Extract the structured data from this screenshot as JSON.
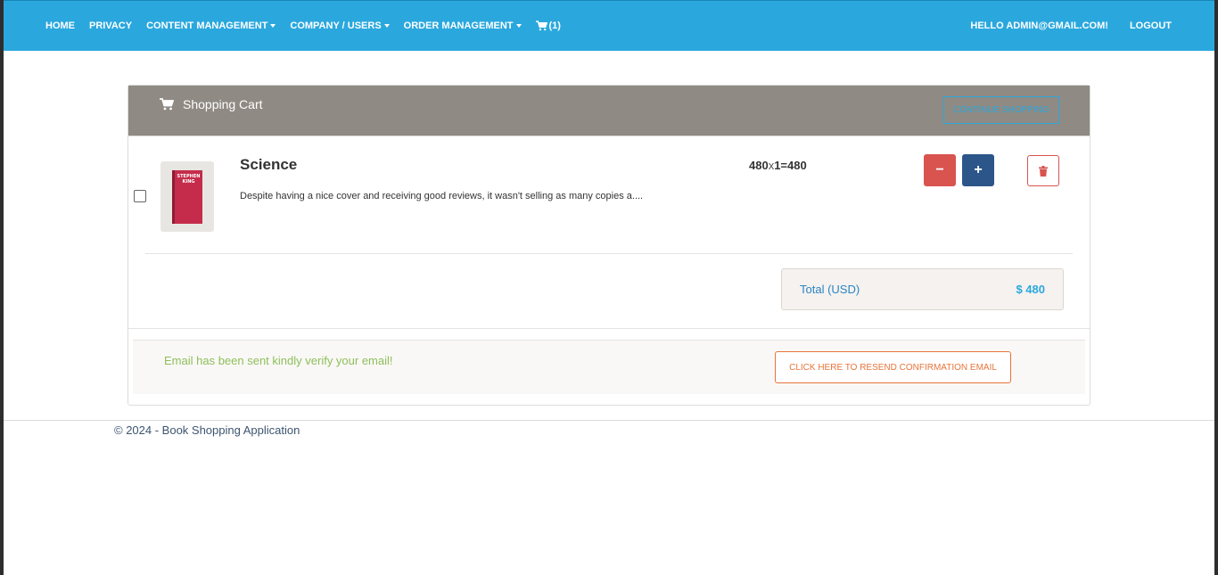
{
  "navbar": {
    "items": [
      {
        "label": "HOME",
        "dropdown": false
      },
      {
        "label": "PRIVACY",
        "dropdown": false
      },
      {
        "label": "CONTENT MANAGEMENT",
        "dropdown": true
      },
      {
        "label": "COMPANY / USERS",
        "dropdown": true
      },
      {
        "label": "ORDER MANAGEMENT",
        "dropdown": true
      }
    ],
    "cart_count": "(1)",
    "greeting": "HELLO ADMIN@GMAIL.COM!",
    "logout": "LOGOUT"
  },
  "cart": {
    "title": "Shopping Cart",
    "continue_label": "CONTINUE SHOPPING",
    "items": [
      {
        "title": "Science",
        "description": "Despite having a nice cover and receiving good reviews, it wasn't selling as many copies a....",
        "price": "480",
        "times": "x",
        "calc_rest": "1=480",
        "minus_label": "−",
        "plus_label": "+",
        "cover_text": [
          "STEPHEN",
          "KING"
        ]
      }
    ],
    "total_label": "Total (USD)",
    "total_value": "$ 480"
  },
  "notice": {
    "message": "Email has been sent kindly verify your email!",
    "resend_label": "CLICK HERE TO RESEND CONFIRMATION EMAIL"
  },
  "footer": {
    "text": "© 2024 - Book Shopping Application"
  },
  "colors": {
    "nav_bg": "#2aa8de",
    "card_header_bg": "#8f8a83",
    "minus_btn": "#d9534f",
    "plus_btn": "#2c5689",
    "notice_text": "#8dbf5b",
    "resend_btn": "#e8743b"
  }
}
